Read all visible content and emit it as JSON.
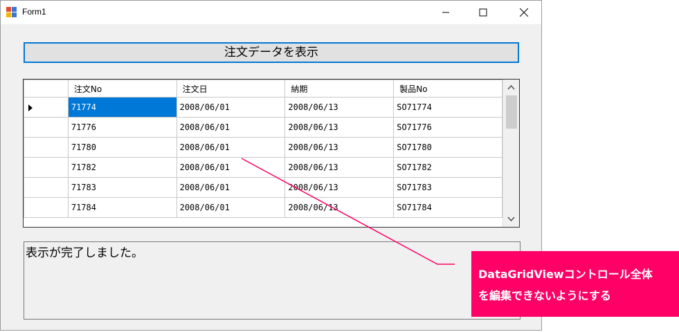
{
  "window": {
    "title": "Form1"
  },
  "title_buttons": {
    "minimize": "minimize",
    "maximize": "maximize",
    "close": "close"
  },
  "button": {
    "label": "注文データを表示"
  },
  "grid": {
    "columns": [
      "注文No",
      "注文日",
      "納期",
      "製品No"
    ],
    "rows": [
      [
        "71774",
        "2008/06/01",
        "2008/06/13",
        "SO71774"
      ],
      [
        "71776",
        "2008/06/01",
        "2008/06/13",
        "SO71776"
      ],
      [
        "71780",
        "2008/06/01",
        "2008/06/13",
        "SO71780"
      ],
      [
        "71782",
        "2008/06/01",
        "2008/06/13",
        "SO71782"
      ],
      [
        "71783",
        "2008/06/01",
        "2008/06/13",
        "SO71783"
      ],
      [
        "71784",
        "2008/06/01",
        "2008/06/13",
        "SO71784"
      ]
    ],
    "current_row": 0,
    "current_col": 0
  },
  "status": {
    "text": "表示が完了しました。"
  },
  "annotation": {
    "line1": "DataGridViewコントロール全体",
    "line2": "を編集できないようにする",
    "color": "#ff0066"
  },
  "colors": {
    "accent": "#0078d7",
    "annotation": "#ff0066"
  }
}
